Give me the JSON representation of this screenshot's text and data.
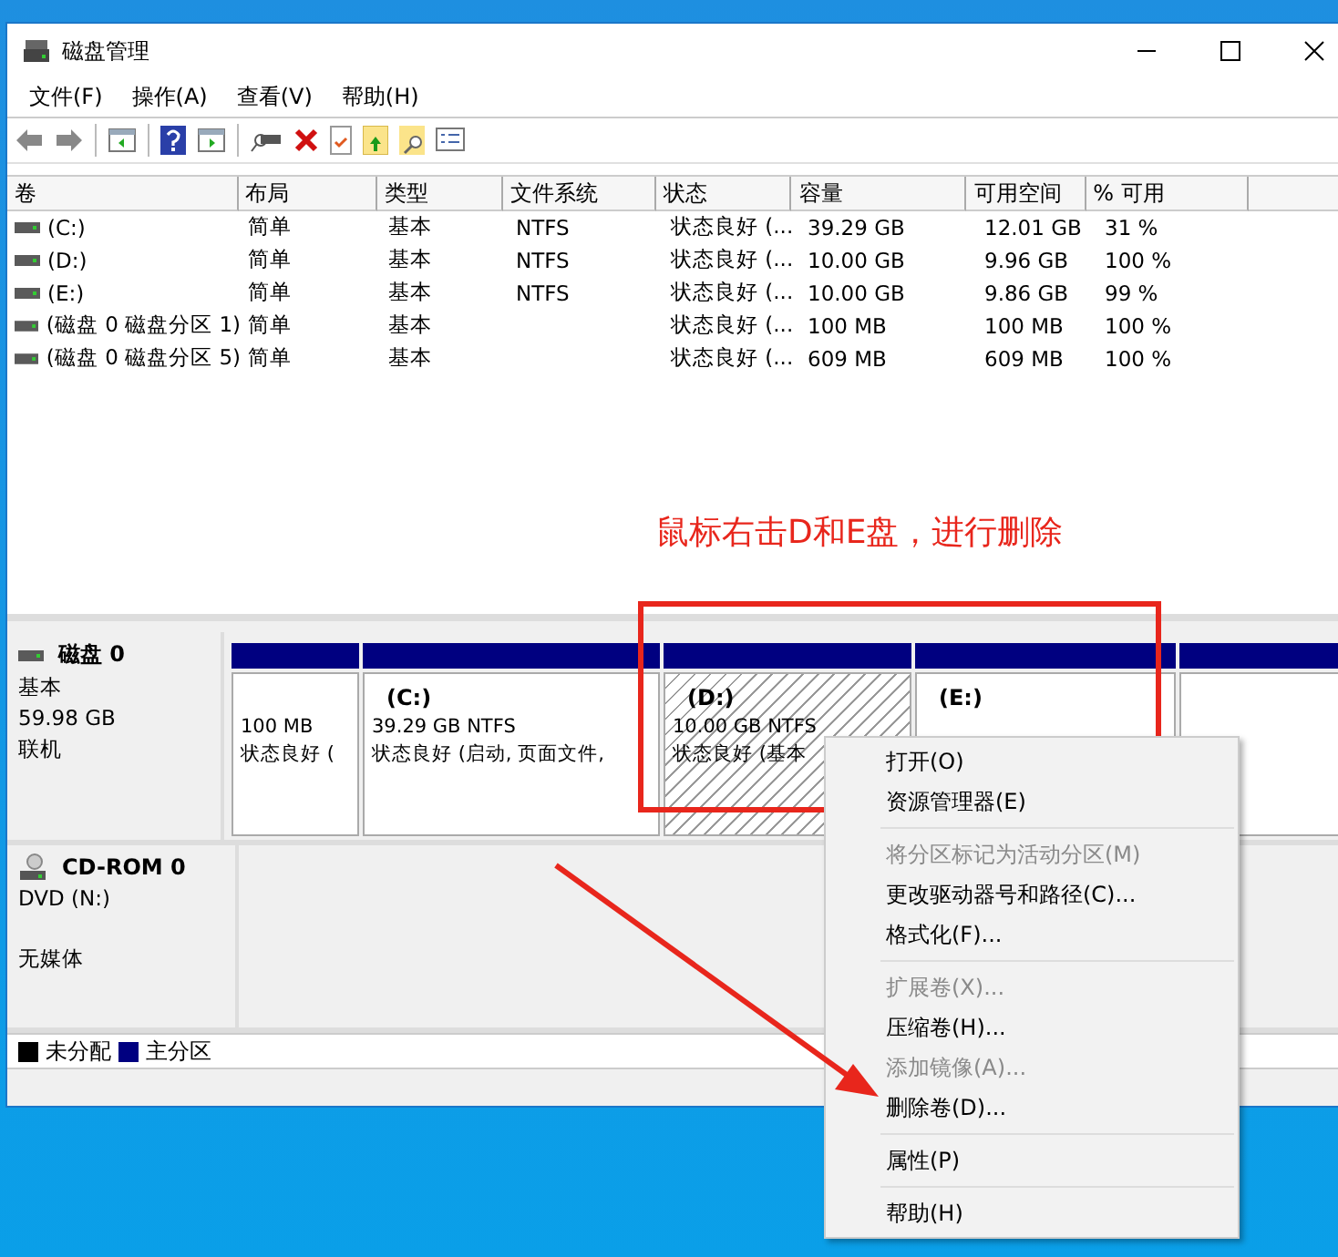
{
  "window": {
    "title": "磁盘管理"
  },
  "menu_bar": [
    "文件(F)",
    "操作(A)",
    "查看(V)",
    "帮助(H)"
  ],
  "table": {
    "columns": [
      "卷",
      "布局",
      "类型",
      "文件系统",
      "状态",
      "容量",
      "可用空间",
      "% 可用"
    ],
    "rows": [
      [
        "(C:)",
        "简单",
        "基本",
        "NTFS",
        "状态良好 (...",
        "39.29 GB",
        "12.01 GB",
        "31 %"
      ],
      [
        "(D:)",
        "简单",
        "基本",
        "NTFS",
        "状态良好 (...",
        "10.00 GB",
        "9.96 GB",
        "100 %"
      ],
      [
        "(E:)",
        "简单",
        "基本",
        "NTFS",
        "状态良好 (...",
        "10.00 GB",
        "9.86 GB",
        "99 %"
      ],
      [
        "(磁盘 0 磁盘分区 1)",
        "简单",
        "基本",
        "",
        "状态良好 (...",
        "100 MB",
        "100 MB",
        "100 %"
      ],
      [
        "(磁盘 0 磁盘分区 5)",
        "简单",
        "基本",
        "",
        "状态良好 (...",
        "609 MB",
        "609 MB",
        "100 %"
      ]
    ]
  },
  "disks": [
    {
      "kind": "disk",
      "name": "磁盘 0",
      "lines": [
        "基本",
        "59.98 GB",
        "联机"
      ],
      "partitions": [
        {
          "lines": [
            "100 MB",
            "状态良好 ("
          ],
          "selected": false
        },
        {
          "label": "(C:)",
          "lines": [
            "39.29 GB NTFS",
            "状态良好 (启动, 页面文件,"
          ],
          "selected": false
        },
        {
          "label": "(D:)",
          "lines": [
            "10.00 GB NTFS",
            "状态良好 (基本"
          ],
          "selected": true
        },
        {
          "label": "(E:)",
          "selected": false
        },
        {
          "selected": false
        }
      ]
    },
    {
      "kind": "cdrom",
      "name": "CD-ROM 0",
      "lines": [
        "DVD (N:)",
        "无媒体"
      ]
    }
  ],
  "legend": [
    {
      "label": "未分配",
      "color": "#000000"
    },
    {
      "label": "主分区",
      "color": "#000080"
    }
  ],
  "annotation": {
    "text": "鼠标右击D和E盘，进行删除"
  },
  "context_menu": [
    {
      "kind": "item",
      "label": "打开(O)",
      "disabled": false
    },
    {
      "kind": "item",
      "label": "资源管理器(E)",
      "disabled": false
    },
    {
      "kind": "separator"
    },
    {
      "kind": "item",
      "label": "将分区标记为活动分区(M)",
      "disabled": true
    },
    {
      "kind": "item",
      "label": "更改驱动器号和路径(C)...",
      "disabled": false
    },
    {
      "kind": "item",
      "label": "格式化(F)...",
      "disabled": false
    },
    {
      "kind": "separator"
    },
    {
      "kind": "item",
      "label": "扩展卷(X)...",
      "disabled": true
    },
    {
      "kind": "item",
      "label": "压缩卷(H)...",
      "disabled": false
    },
    {
      "kind": "item",
      "label": "添加镜像(A)...",
      "disabled": true
    },
    {
      "kind": "item",
      "label": "删除卷(D)...",
      "disabled": false
    },
    {
      "kind": "separator"
    },
    {
      "kind": "item",
      "label": "属性(P)",
      "disabled": false
    },
    {
      "kind": "separator"
    },
    {
      "kind": "item",
      "label": "帮助(H)",
      "disabled": false
    }
  ]
}
